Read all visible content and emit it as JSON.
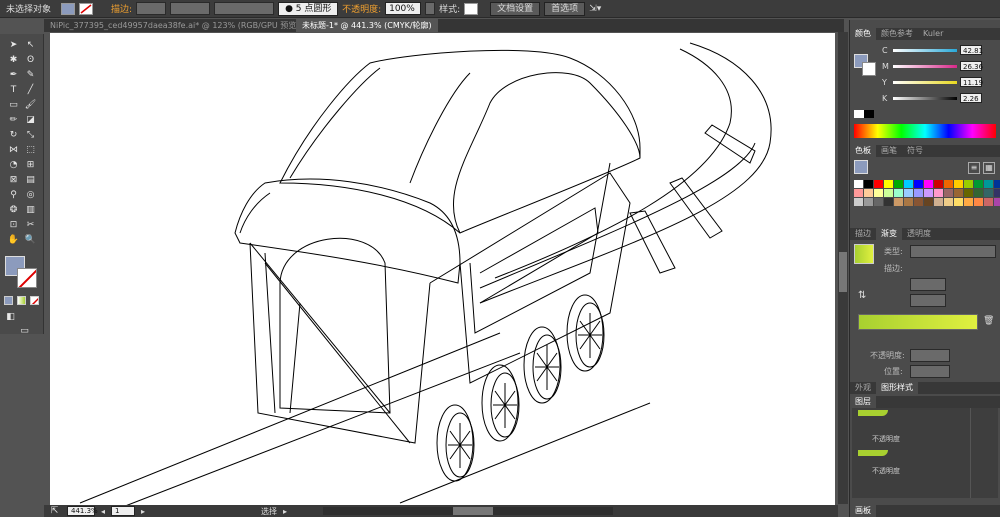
{
  "control_bar": {
    "selection_label": "未选择对象",
    "stroke_label": "描边:",
    "brush_label": "5 点圆形",
    "opacity_label": "不透明度:",
    "opacity_value": "100%",
    "style_label": "样式:",
    "doc_setup_button": "文档设置",
    "preferences_button": "首选项"
  },
  "doc_tabs": [
    {
      "label": "NiPic_377395_ced49957daea38fe.ai* @ 123% (RGB/GPU 预览)",
      "active": false
    },
    {
      "label": "未标题-1* @ 441.3% (CMYK/轮廓)",
      "active": true
    }
  ],
  "status_bar": {
    "zoom": "441.3%",
    "artboard_number": "1",
    "tool_name": "选择"
  },
  "color_panel": {
    "tabs": [
      "颜色",
      "颜色参考",
      "Kuler"
    ],
    "sliders": [
      {
        "channel": "C",
        "value": "42.81",
        "color": "#29a8d8"
      },
      {
        "channel": "M",
        "value": "26.36",
        "color": "#d8288a"
      },
      {
        "channel": "Y",
        "value": "11.19",
        "color": "#e8d820"
      },
      {
        "channel": "K",
        "value": "2.26",
        "color": "#333333"
      }
    ]
  },
  "swatches_panel": {
    "tabs": [
      "色板",
      "画笔",
      "符号"
    ]
  },
  "stroke_gradient_panel": {
    "tabs": [
      "描边",
      "渐变",
      "透明度"
    ],
    "type_label": "类型:",
    "stroke_label": "描边:",
    "opacity_label": "不透明度:",
    "location_label": "位置:",
    "gradient_from": "#a8d030",
    "gradient_to": "#e0f040"
  },
  "appearance_panel": {
    "tabs": [
      "外观",
      "图形样式"
    ]
  },
  "layers_panel": {
    "title": "图层",
    "rows": [
      "不透明度",
      "不透明度"
    ]
  },
  "artboards_panel": {
    "title": "画板"
  },
  "colors": {
    "fill_swatch": "#8c9bbd",
    "accent_orange": "#f0a030"
  }
}
